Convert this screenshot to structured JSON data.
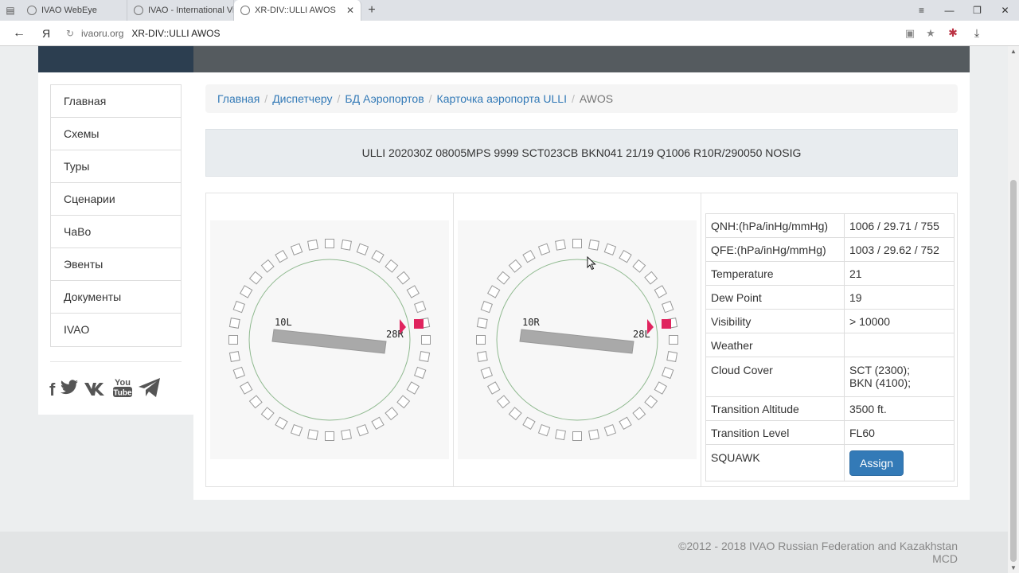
{
  "browser": {
    "tabs": [
      {
        "title": "IVAO WebEye"
      },
      {
        "title": "IVAO - International Virtual A"
      },
      {
        "title": "XR-DIV::ULLI AWOS"
      }
    ],
    "address": {
      "yandex_label": "Я",
      "domain": "ivaoru.org",
      "title": "XR-DIV::ULLI AWOS"
    }
  },
  "sidebar": {
    "items": [
      {
        "label": "Главная"
      },
      {
        "label": "Схемы"
      },
      {
        "label": "Туры"
      },
      {
        "label": "Сценарии"
      },
      {
        "label": "ЧаВо"
      },
      {
        "label": "Эвенты"
      },
      {
        "label": "Документы"
      },
      {
        "label": "IVAO"
      }
    ],
    "social_icons": [
      "facebook-icon",
      "twitter-icon",
      "vk-icon",
      "youtube-icon",
      "telegram-icon"
    ],
    "youtube_label_top": "You",
    "youtube_label_bottom": "Tube"
  },
  "breadcrumb": {
    "items": [
      {
        "label": "Главная"
      },
      {
        "label": "Диспетчеру"
      },
      {
        "label": "БД Аэропортов"
      },
      {
        "label": "Карточка аэропорта ULLI"
      }
    ],
    "current": "AWOS"
  },
  "metar": "ULLI 202030Z 08005MPS 9999 SCT023CB BKN041 21/19 Q1006 R10R/290050 NOSIG",
  "runways": [
    {
      "end_a": "10L",
      "end_b": "28R"
    },
    {
      "end_a": "10R",
      "end_b": "28L"
    }
  ],
  "info": {
    "qnh_label": "QNH:(hPa/inHg/mmHg)",
    "qnh_value": "1006 / 29.71 / 755",
    "qfe_label": "QFE:(hPa/inHg/mmHg)",
    "qfe_value": "1003 / 29.62 / 752",
    "temp_label": "Temperature",
    "temp_value": "21",
    "dew_label": "Dew Point",
    "dew_value": "19",
    "vis_label": "Visibility",
    "vis_value": "> 10000",
    "weather_label": "Weather",
    "weather_value": "",
    "cloud_label": "Cloud Cover",
    "cloud_value_1": "SCT (2300);",
    "cloud_value_2": "BKN (4100);",
    "ta_label": "Transition Altitude",
    "ta_value": "3500 ft.",
    "tl_label": "Transition Level",
    "tl_value": "FL60",
    "squawk_label": "SQUAWK",
    "assign_label": "Assign"
  },
  "footer": {
    "line1": "©2012 - 2018 IVAO Russian Federation and Kazakhstan",
    "line2": "MCD"
  },
  "colors": {
    "nav_dark": "#2c3e50",
    "nav_gray": "#555b5f",
    "link": "#337ab7",
    "button": "#337ab7",
    "wind_marker": "#e0245e"
  }
}
